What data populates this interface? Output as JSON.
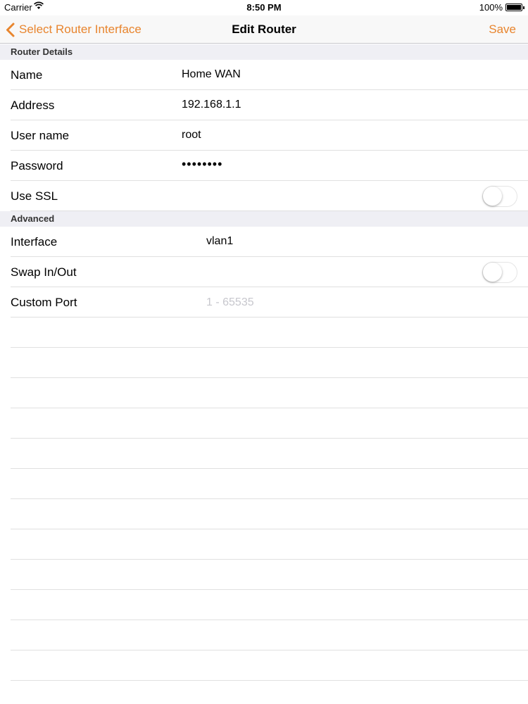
{
  "status_bar": {
    "carrier": "Carrier",
    "time": "8:50 PM",
    "battery": "100%"
  },
  "nav": {
    "back_label": "Select Router Interface",
    "title": "Edit Router",
    "save_label": "Save"
  },
  "sections": {
    "router_details": {
      "header": "Router Details",
      "name": {
        "label": "Name",
        "value": "Home WAN"
      },
      "address": {
        "label": "Address",
        "value": "192.168.1.1"
      },
      "username": {
        "label": "User name",
        "value": "root"
      },
      "password": {
        "label": "Password",
        "value": "••••••••"
      },
      "use_ssl": {
        "label": "Use SSL",
        "on": false
      }
    },
    "advanced": {
      "header": "Advanced",
      "interface": {
        "label": "Interface",
        "value": "vlan1"
      },
      "swap": {
        "label": "Swap In/Out",
        "on": false
      },
      "custom_port": {
        "label": "Custom Port",
        "placeholder": "1 - 65535"
      }
    }
  },
  "colors": {
    "accent": "#e8852e",
    "section_bg": "#efeff4",
    "separator": "#e0e0e0",
    "placeholder": "#c7c7cd"
  }
}
